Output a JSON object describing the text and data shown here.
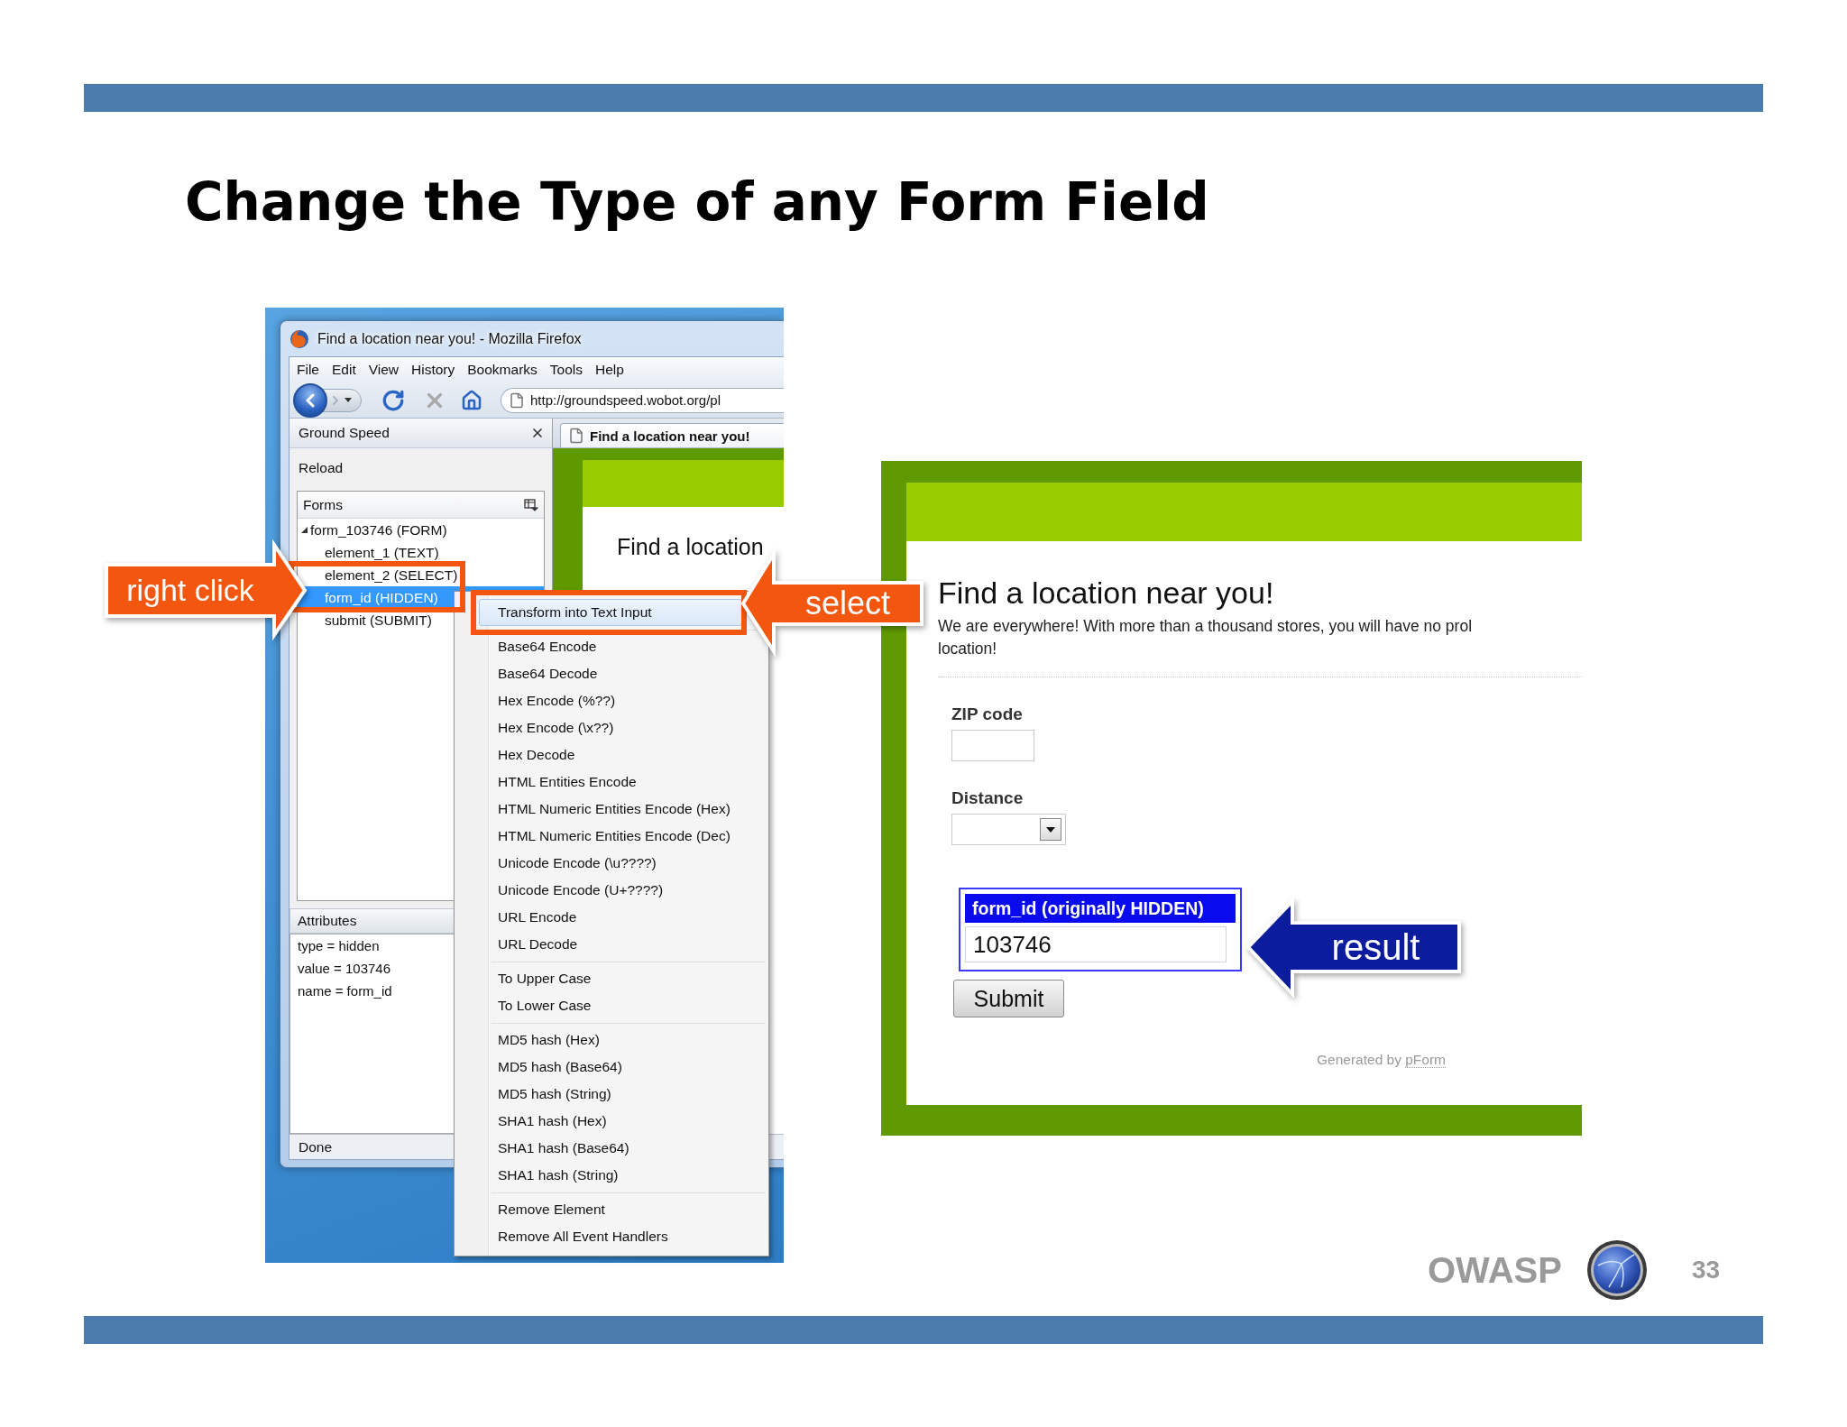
{
  "title": "Change the Type of any Form Field",
  "browser": {
    "window_title": "Find a location near you! - Mozilla Firefox",
    "menu": [
      "File",
      "Edit",
      "View",
      "History",
      "Bookmarks",
      "Tools",
      "Help"
    ],
    "url": "http://groundspeed.wobot.org/pl",
    "sidebar": {
      "title": "Ground Speed",
      "reload": "Reload",
      "forms_header": "Forms",
      "tree": [
        {
          "label": "form_103746 (FORM)",
          "expanded": true,
          "selected": false,
          "children": [
            {
              "label": "element_1 (TEXT)",
              "selected": false
            },
            {
              "label": "element_2 (SELECT)",
              "selected": false
            },
            {
              "label": "form_id (HIDDEN)",
              "selected": true
            },
            {
              "label": "submit (SUBMIT)",
              "selected": false
            }
          ]
        }
      ],
      "attributes_header": "Attributes",
      "attributes": [
        "type = hidden",
        "value = 103746",
        "name = form_id"
      ]
    },
    "tab_title": "Find a location near you!",
    "page_heading": "Find a location",
    "status": "Done"
  },
  "context_menu": {
    "groups": [
      [
        {
          "label": "Transform into Text Input",
          "selected": true
        }
      ],
      [
        {
          "label": "Base64 Encode",
          "selected": false
        },
        {
          "label": "Base64 Decode",
          "selected": false
        },
        {
          "label": "Hex Encode (%??)",
          "selected": false
        },
        {
          "label": "Hex Encode (\\x??)",
          "selected": false
        },
        {
          "label": "Hex Decode",
          "selected": false
        },
        {
          "label": "HTML Entities Encode",
          "selected": false
        },
        {
          "label": "HTML Numeric Entities Encode (Hex)",
          "selected": false
        },
        {
          "label": "HTML Numeric Entities Encode (Dec)",
          "selected": false
        },
        {
          "label": "Unicode Encode (\\u????)",
          "selected": false
        },
        {
          "label": "Unicode Encode (U+????)",
          "selected": false
        },
        {
          "label": "URL Encode",
          "selected": false
        },
        {
          "label": "URL Decode",
          "selected": false
        }
      ],
      [
        {
          "label": "To Upper Case",
          "selected": false
        },
        {
          "label": "To Lower Case",
          "selected": false
        }
      ],
      [
        {
          "label": "MD5 hash (Hex)",
          "selected": false
        },
        {
          "label": "MD5 hash (Base64)",
          "selected": false
        },
        {
          "label": "MD5 hash (String)",
          "selected": false
        },
        {
          "label": "SHA1 hash (Hex)",
          "selected": false
        },
        {
          "label": "SHA1 hash (Base64)",
          "selected": false
        },
        {
          "label": "SHA1 hash (String)",
          "selected": false
        }
      ],
      [
        {
          "label": "Remove Element",
          "selected": false
        },
        {
          "label": "Remove All Event Handlers",
          "selected": false
        }
      ]
    ]
  },
  "callouts": [
    {
      "text": "right click",
      "kind": "right",
      "color": "#f2560f"
    },
    {
      "text": "select",
      "kind": "left",
      "color": "#f2560f"
    },
    {
      "text": "result",
      "kind": "left",
      "color": "#0b1d9e"
    }
  ],
  "form_page": {
    "heading": "Find a location near you!",
    "intro": [
      "We are everywhere! With more than a thousand stores, you will have no prol",
      "location!"
    ],
    "zip_label": "ZIP code",
    "distance_label": "Distance",
    "revealed_label": "form_id (originally HIDDEN)",
    "revealed_value": "103746",
    "submit": "Submit",
    "credit": "Generated by",
    "credit_link": "pForm"
  },
  "footer": {
    "logo_text": "OWASP",
    "page_number": "33"
  }
}
